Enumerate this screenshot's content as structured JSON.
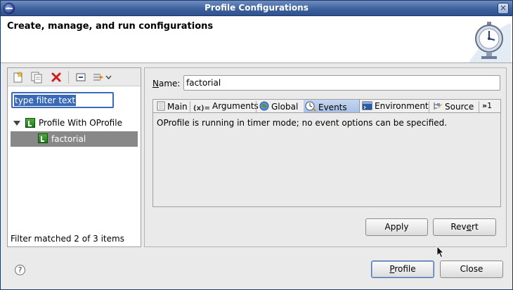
{
  "window": {
    "title": "Profile Configurations"
  },
  "banner": {
    "heading": "Create, manage, and run configurations",
    "icon": "stopwatch-icon"
  },
  "sidebar": {
    "toolbar": [
      "new-configuration-icon",
      "duplicate-icon",
      "delete-icon",
      "collapse-all-icon",
      "filter-menu-icon"
    ],
    "filter_placeholder": "type filter text",
    "tree": {
      "root_label": "Profile With OProfile",
      "children": [
        {
          "label": "factorial",
          "selected": true
        }
      ]
    },
    "status": "Filter matched 2 of 3 items"
  },
  "editor": {
    "name_label_prefix": "",
    "name_label_mnemonic": "N",
    "name_label_rest": "ame:",
    "name_value": "factorial",
    "tabs": [
      {
        "label": "Main",
        "icon": "main-tab-icon"
      },
      {
        "label": "Arguments",
        "icon": "arguments-tab-icon"
      },
      {
        "label": "Global",
        "icon": "globe-icon"
      },
      {
        "label": "Events",
        "icon": "events-clock-icon",
        "active": true
      },
      {
        "label": "Environment",
        "icon": "environment-icon"
      },
      {
        "label": "Source",
        "icon": "source-icon"
      }
    ],
    "overflow_label": "1",
    "events_message": "OProfile is running in timer mode; no event options can be specified.",
    "apply_label": "Apply",
    "revert_label_a": "Rev",
    "revert_label_mn": "e",
    "revert_label_b": "rt"
  },
  "footer": {
    "help_label": "?",
    "profile_label_mn": "P",
    "profile_label_rest": "rofile",
    "close_label": "Close"
  },
  "colors": {
    "selection": "#3a69b5",
    "tree_selected_bg": "#888888",
    "active_tab": "#a7c0e5"
  }
}
